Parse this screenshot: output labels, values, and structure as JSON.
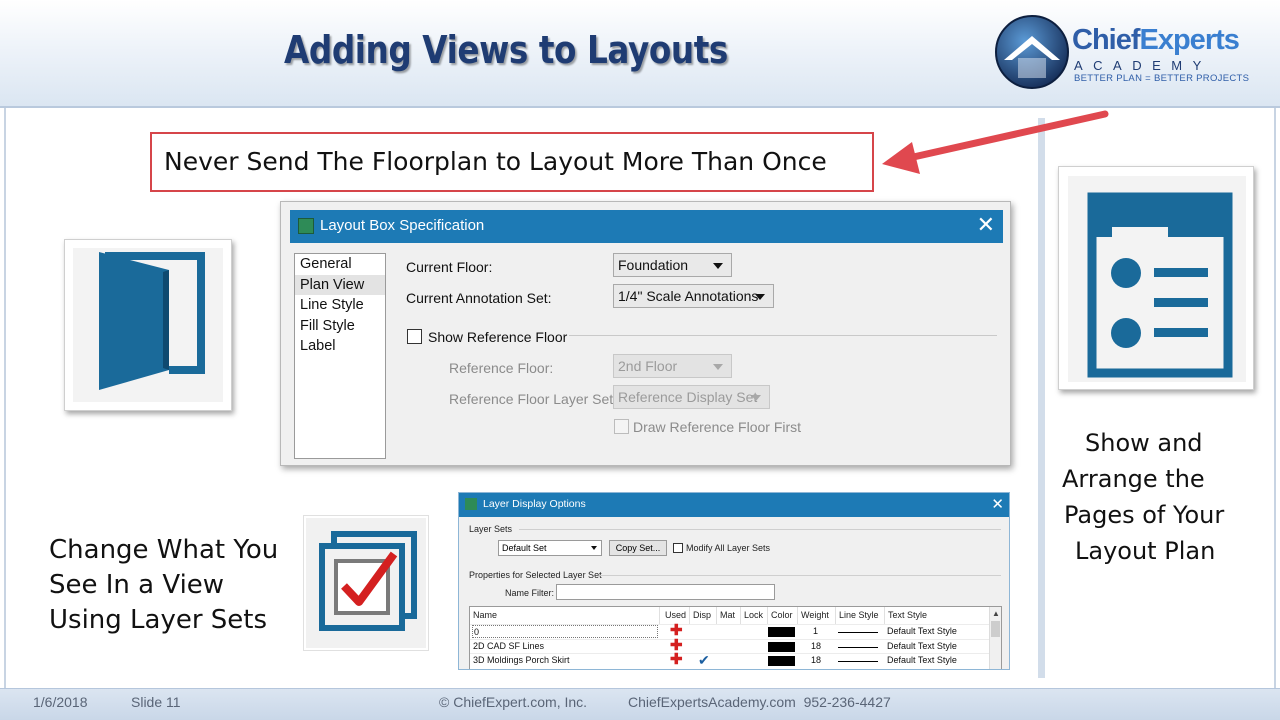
{
  "slide": {
    "title": "Adding Views to Layouts",
    "callout": "Never Send The Floorplan to Layout More Than Once",
    "left_text": [
      "Change What You",
      "See In a View",
      "Using Layer Sets"
    ],
    "right_text": [
      "Show and",
      "Arrange the",
      "Pages of Your",
      "Layout Plan"
    ],
    "accent_color": "#1f3c73",
    "callout_color": "#d6454a",
    "icon_color": "#1a6a9a"
  },
  "logo": {
    "name_part1": "Chief",
    "name_part2": "Experts",
    "sub": "ACADEMY",
    "tagline": "BETTER PLAN = BETTER PROJECTS"
  },
  "footer": {
    "date": "1/6/2018",
    "slide_number": "Slide 11",
    "copyright": "© ChiefExpert.com, Inc.",
    "contact": "ChiefExpertsAcademy.com  952-236-4427"
  },
  "layout_box_dialog": {
    "title": "Layout Box Specification",
    "close": "✕",
    "categories": [
      "General",
      "Plan View",
      "Line Style",
      "Fill Style",
      "Label"
    ],
    "selected_category": "Plan View",
    "current_floor_label": "Current Floor:",
    "current_floor_value": "Foundation",
    "annotation_set_label": "Current Annotation Set:",
    "annotation_set_value": "1/4\" Scale Annotations",
    "show_reference_label": "Show Reference Floor",
    "reference_floor_label": "Reference Floor:",
    "reference_floor_value": "2nd Floor",
    "reference_layer_set_label": "Reference Floor Layer Set:",
    "reference_layer_set_value": "Reference Display Set",
    "draw_first_label": "Draw Reference Floor First"
  },
  "layer_dialog": {
    "title": "Layer Display Options",
    "close": "✕",
    "layer_sets_label": "Layer Sets",
    "layer_set_value": "Default Set",
    "copy_set_button": "Copy Set...",
    "modify_all_label": "Modify All Layer Sets",
    "properties_label": "Properties for Selected Layer Set",
    "name_filter_label": "Name Filter:",
    "columns": [
      "Name",
      "Used",
      "Disp",
      "Mat",
      "Lock",
      "Color",
      "Weight",
      "Line Style",
      "Text Style"
    ],
    "rows": [
      {
        "name": "0",
        "used": true,
        "disp": false,
        "weight": "1",
        "text_style": "Default Text Style"
      },
      {
        "name": "2D CAD SF Lines",
        "used": true,
        "disp": false,
        "weight": "18",
        "text_style": "Default Text Style"
      },
      {
        "name": "3D Moldings Porch Skirt",
        "used": true,
        "disp": true,
        "weight": "18",
        "text_style": "Default Text Style"
      }
    ]
  },
  "icons": {
    "left_top": "open-door-icon",
    "left_bottom": "layer-checkbox-icon",
    "right": "page-layout-icon",
    "arrow": "red-arrow-icon"
  }
}
